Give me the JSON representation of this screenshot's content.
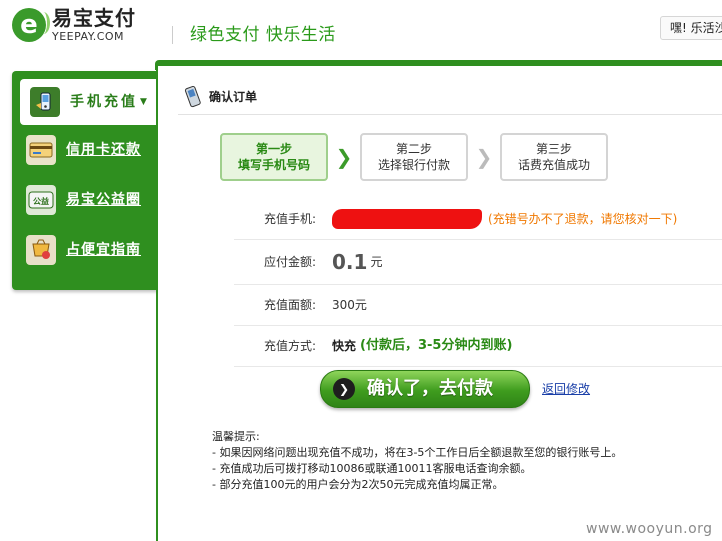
{
  "header": {
    "logo_cn": "易宝支付",
    "logo_en": "YEEPAY.COM",
    "slogan": "绿色支付  快乐生活",
    "user_greeting": "嘿! 乐活沙"
  },
  "sidebar": {
    "items": [
      {
        "label": "手机充值",
        "icon": "mobile-phone-icon",
        "active": true
      },
      {
        "label": "信用卡还款",
        "icon": "credit-card-icon",
        "active": false
      },
      {
        "label": "易宝公益圈",
        "icon": "charity-icon",
        "active": false
      },
      {
        "label": "占便宜指南",
        "icon": "guide-icon",
        "active": false
      }
    ]
  },
  "main": {
    "title": "确认订单",
    "steps": [
      {
        "line1": "第一步",
        "line2": "填写手机号码",
        "current": true
      },
      {
        "line1": "第二步",
        "line2": "选择银行付款",
        "current": false
      },
      {
        "line1": "第三步",
        "line2": "话费充值成功",
        "current": false
      }
    ],
    "phone_label": "充值手机:",
    "phone_warning": "(充错号办不了退款，请您核对一下)",
    "amount_label": "应付金额:",
    "amount_value": "0.1",
    "amount_unit": "元",
    "face_label": "充值面额:",
    "face_value": "300元",
    "method_label": "充值方式:",
    "method_value": "快充",
    "method_note": "(付款后，3-5分钟内到账)",
    "pay_button": "确认了，去付款",
    "back_link": "返回修改",
    "tips": [
      "温馨提示:",
      "- 如果因网络问题出现充值不成功，将在3-5个工作日后全额退款至您的银行账号上。",
      "- 充值成功后可拨打移动10086或联通10011客服电话查询余额。",
      "- 部分充值100元的用户会分为2次50元完成充值均属正常。"
    ]
  },
  "watermark": "www.wooyun.org",
  "colors": {
    "brand_green": "#2f8f1f",
    "warning_orange": "#f07800",
    "link_blue": "#1a3fa8"
  }
}
